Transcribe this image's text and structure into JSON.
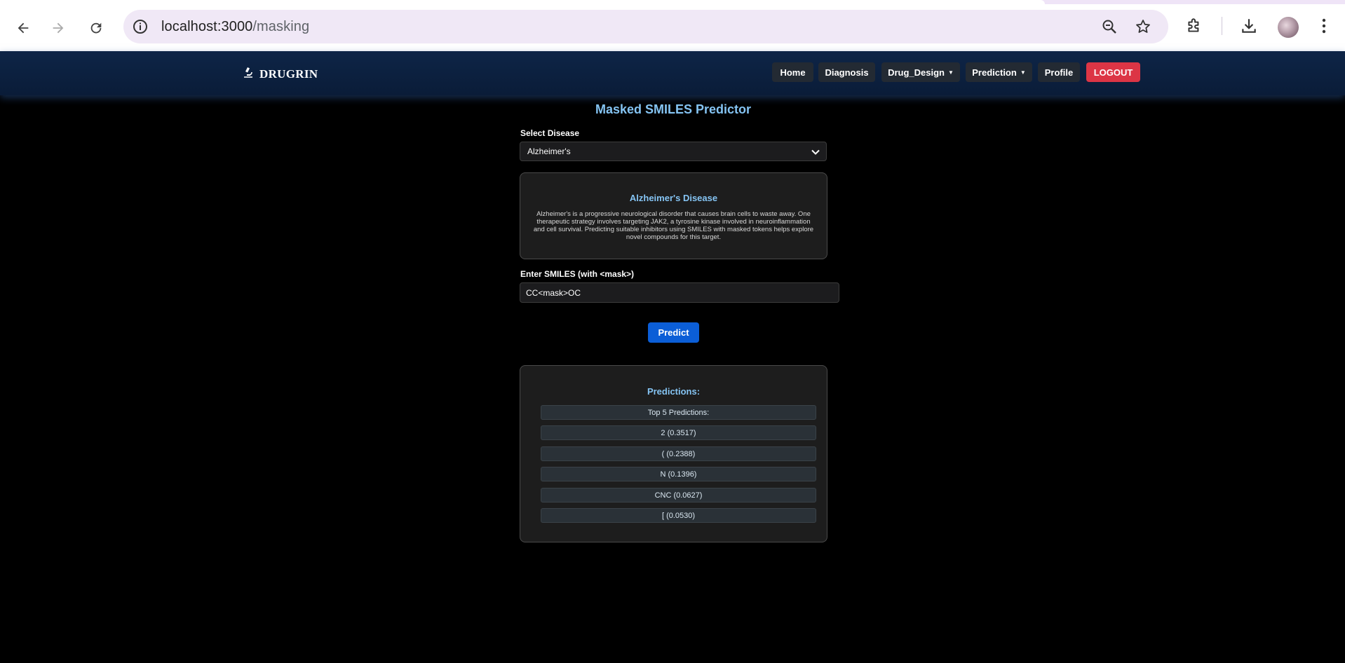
{
  "browser": {
    "url_host": "localhost:3000",
    "url_path": "/masking"
  },
  "navbar": {
    "brand": "DRUGRIN",
    "items": [
      {
        "label": "Home",
        "dropdown": false
      },
      {
        "label": "Diagnosis",
        "dropdown": false
      },
      {
        "label": "Drug_Design",
        "dropdown": true
      },
      {
        "label": "Prediction",
        "dropdown": true
      },
      {
        "label": "Profile",
        "dropdown": false
      }
    ],
    "logout_label": "LOGOUT"
  },
  "page": {
    "title": "Masked SMILES Predictor",
    "disease_label": "Select Disease",
    "disease_value": "Alzheimer's",
    "info_title": "Alzheimer's Disease",
    "info_text": "Alzheimer's is a progressive neurological disorder that causes brain cells to waste away. One therapeutic strategy involves targeting JAK2, a tyrosine kinase involved in neuroinflammation and cell survival. Predicting suitable inhibitors using SMILES with masked tokens helps explore novel compounds for this target.",
    "smiles_label": "Enter SMILES (with <mask>)",
    "smiles_value": "CC<mask>OC",
    "predict_label": "Predict"
  },
  "results": {
    "title": "Predictions:",
    "header": "Top 5 Predictions:",
    "items": [
      "2 (0.3517)",
      "( (0.2388)",
      "N (0.1396)",
      "CNC (0.0627)",
      "[ (0.0530)"
    ]
  },
  "colors": {
    "accent": "#85c4f3",
    "navbar": "#0e2547",
    "logout": "#dc3545",
    "primary": "#0b5ed7"
  }
}
